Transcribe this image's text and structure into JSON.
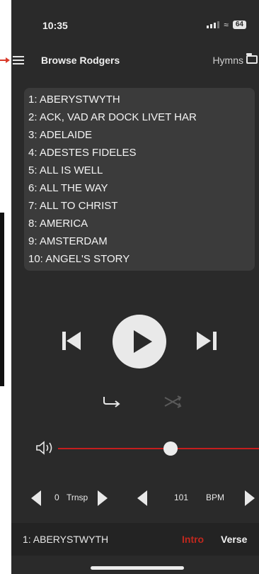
{
  "status_bar": {
    "time": "10:35",
    "battery": "64"
  },
  "nav": {
    "title": "Browse Rodgers",
    "collection_label": "Hymns"
  },
  "song_list": [
    "1: ABERYSTWYTH",
    "2: ACK, VAD AR DOCK LIVET HAR",
    "3: ADELAIDE",
    "4: ADESTES FIDELES",
    "5: ALL IS WELL",
    "6: ALL THE WAY",
    "7: ALL TO CHRIST",
    "8: AMERICA",
    "9: AMSTERDAM",
    "10: ANGEL'S STORY"
  ],
  "volume": {
    "level": 0.56,
    "track_color": "#c41e1e"
  },
  "transpose": {
    "value": "0",
    "label": "Trnsp"
  },
  "tempo": {
    "value": "101",
    "label": "BPM"
  },
  "footer": {
    "current_song": "1: ABERYSTWYTH",
    "intro_label": "Intro",
    "verse_label": "Verse",
    "intro_color": "#c0281e"
  },
  "colors": {
    "background": "#2a2a2a",
    "list_background": "#3b3b3b",
    "accent": "#c41e1e"
  },
  "icons": [
    "menu-icon",
    "folder-icon",
    "previous-icon",
    "play-icon",
    "next-icon",
    "repeat-icon",
    "shuffle-icon",
    "speaker-icon"
  ]
}
